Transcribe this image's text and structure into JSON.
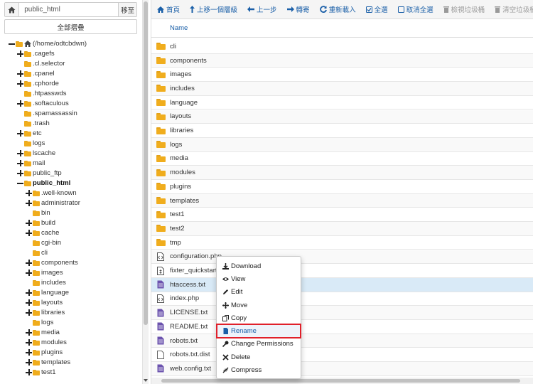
{
  "left": {
    "path_value": "public_html",
    "go_label": "移至",
    "collapse_all_label": "全部摺疊",
    "tree": [
      {
        "label": "(/home/odtcbdwn)",
        "depth": 0,
        "toggle": "minus",
        "icon": "home-icon"
      },
      {
        "label": ".cagefs",
        "depth": 1,
        "toggle": "plus"
      },
      {
        "label": ".cl.selector",
        "depth": 1,
        "toggle": ""
      },
      {
        "label": ".cpanel",
        "depth": 1,
        "toggle": "plus"
      },
      {
        "label": ".cphorde",
        "depth": 1,
        "toggle": "plus"
      },
      {
        "label": ".htpasswds",
        "depth": 1,
        "toggle": ""
      },
      {
        "label": ".softaculous",
        "depth": 1,
        "toggle": "plus"
      },
      {
        "label": ".spamassassin",
        "depth": 1,
        "toggle": ""
      },
      {
        "label": ".trash",
        "depth": 1,
        "toggle": ""
      },
      {
        "label": "etc",
        "depth": 1,
        "toggle": "plus"
      },
      {
        "label": "logs",
        "depth": 1,
        "toggle": ""
      },
      {
        "label": "lscache",
        "depth": 1,
        "toggle": "plus"
      },
      {
        "label": "mail",
        "depth": 1,
        "toggle": "plus"
      },
      {
        "label": "public_ftp",
        "depth": 1,
        "toggle": "plus"
      },
      {
        "label": "public_html",
        "depth": 1,
        "toggle": "minus",
        "bold": true
      },
      {
        "label": ".well-known",
        "depth": 2,
        "toggle": "plus"
      },
      {
        "label": "administrator",
        "depth": 2,
        "toggle": "plus"
      },
      {
        "label": "bin",
        "depth": 2,
        "toggle": ""
      },
      {
        "label": "build",
        "depth": 2,
        "toggle": "plus"
      },
      {
        "label": "cache",
        "depth": 2,
        "toggle": "plus"
      },
      {
        "label": "cgi-bin",
        "depth": 2,
        "toggle": ""
      },
      {
        "label": "cli",
        "depth": 2,
        "toggle": ""
      },
      {
        "label": "components",
        "depth": 2,
        "toggle": "plus"
      },
      {
        "label": "images",
        "depth": 2,
        "toggle": "plus"
      },
      {
        "label": "includes",
        "depth": 2,
        "toggle": ""
      },
      {
        "label": "language",
        "depth": 2,
        "toggle": "plus"
      },
      {
        "label": "layouts",
        "depth": 2,
        "toggle": "plus"
      },
      {
        "label": "libraries",
        "depth": 2,
        "toggle": "plus"
      },
      {
        "label": "logs",
        "depth": 2,
        "toggle": ""
      },
      {
        "label": "media",
        "depth": 2,
        "toggle": "plus"
      },
      {
        "label": "modules",
        "depth": 2,
        "toggle": "plus"
      },
      {
        "label": "plugins",
        "depth": 2,
        "toggle": "plus"
      },
      {
        "label": "templates",
        "depth": 2,
        "toggle": "plus"
      },
      {
        "label": "test1",
        "depth": 2,
        "toggle": "plus"
      }
    ]
  },
  "toolbar": {
    "home": "首頁",
    "up": "上移一個層級",
    "back": "上一步",
    "forward": "轉寄",
    "reload": "重新載入",
    "select_all": "全選",
    "unselect_all": "取消全選",
    "view_trash": "檢視垃圾桶",
    "empty_trash": "清空垃圾桶"
  },
  "list": {
    "header_name": "Name",
    "files": [
      {
        "name": "cli",
        "type": "folder"
      },
      {
        "name": "components",
        "type": "folder"
      },
      {
        "name": "images",
        "type": "folder"
      },
      {
        "name": "includes",
        "type": "folder"
      },
      {
        "name": "language",
        "type": "folder"
      },
      {
        "name": "layouts",
        "type": "folder"
      },
      {
        "name": "libraries",
        "type": "folder"
      },
      {
        "name": "logs",
        "type": "folder"
      },
      {
        "name": "media",
        "type": "folder"
      },
      {
        "name": "modules",
        "type": "folder"
      },
      {
        "name": "plugins",
        "type": "folder"
      },
      {
        "name": "templates",
        "type": "folder"
      },
      {
        "name": "test1",
        "type": "folder"
      },
      {
        "name": "test2",
        "type": "folder"
      },
      {
        "name": "tmp",
        "type": "folder"
      },
      {
        "name": "configuration.php",
        "type": "code"
      },
      {
        "name": "fixter_quickstart_",
        "type": "script"
      },
      {
        "name": "htaccess.txt",
        "type": "text",
        "selected": true
      },
      {
        "name": "index.php",
        "type": "code"
      },
      {
        "name": "LICENSE.txt",
        "type": "text"
      },
      {
        "name": "README.txt",
        "type": "text"
      },
      {
        "name": "robots.txt",
        "type": "text"
      },
      {
        "name": "robots.txt.dist",
        "type": "blank"
      },
      {
        "name": "web.config.txt",
        "type": "text"
      }
    ]
  },
  "context_menu": {
    "items": [
      {
        "label": "Download",
        "icon": "download-icon"
      },
      {
        "label": "View",
        "icon": "eye-icon"
      },
      {
        "label": "Edit",
        "icon": "pencil-icon"
      },
      {
        "label": "Move",
        "icon": "move-icon"
      },
      {
        "label": "Copy",
        "icon": "copy-icon"
      },
      {
        "label": "Rename",
        "icon": "file-icon",
        "highlighted": true
      },
      {
        "label": "Change Permissions",
        "icon": "key-icon"
      },
      {
        "label": "Delete",
        "icon": "times-icon"
      },
      {
        "label": "Compress",
        "icon": "compress-icon"
      }
    ]
  },
  "colors": {
    "link_blue": "#1a5fa8",
    "folder_yellow": "#f0ad1d",
    "file_purple": "#6b52ae",
    "selected_row": "#d9eaf7",
    "highlight_border": "#e0202a"
  }
}
